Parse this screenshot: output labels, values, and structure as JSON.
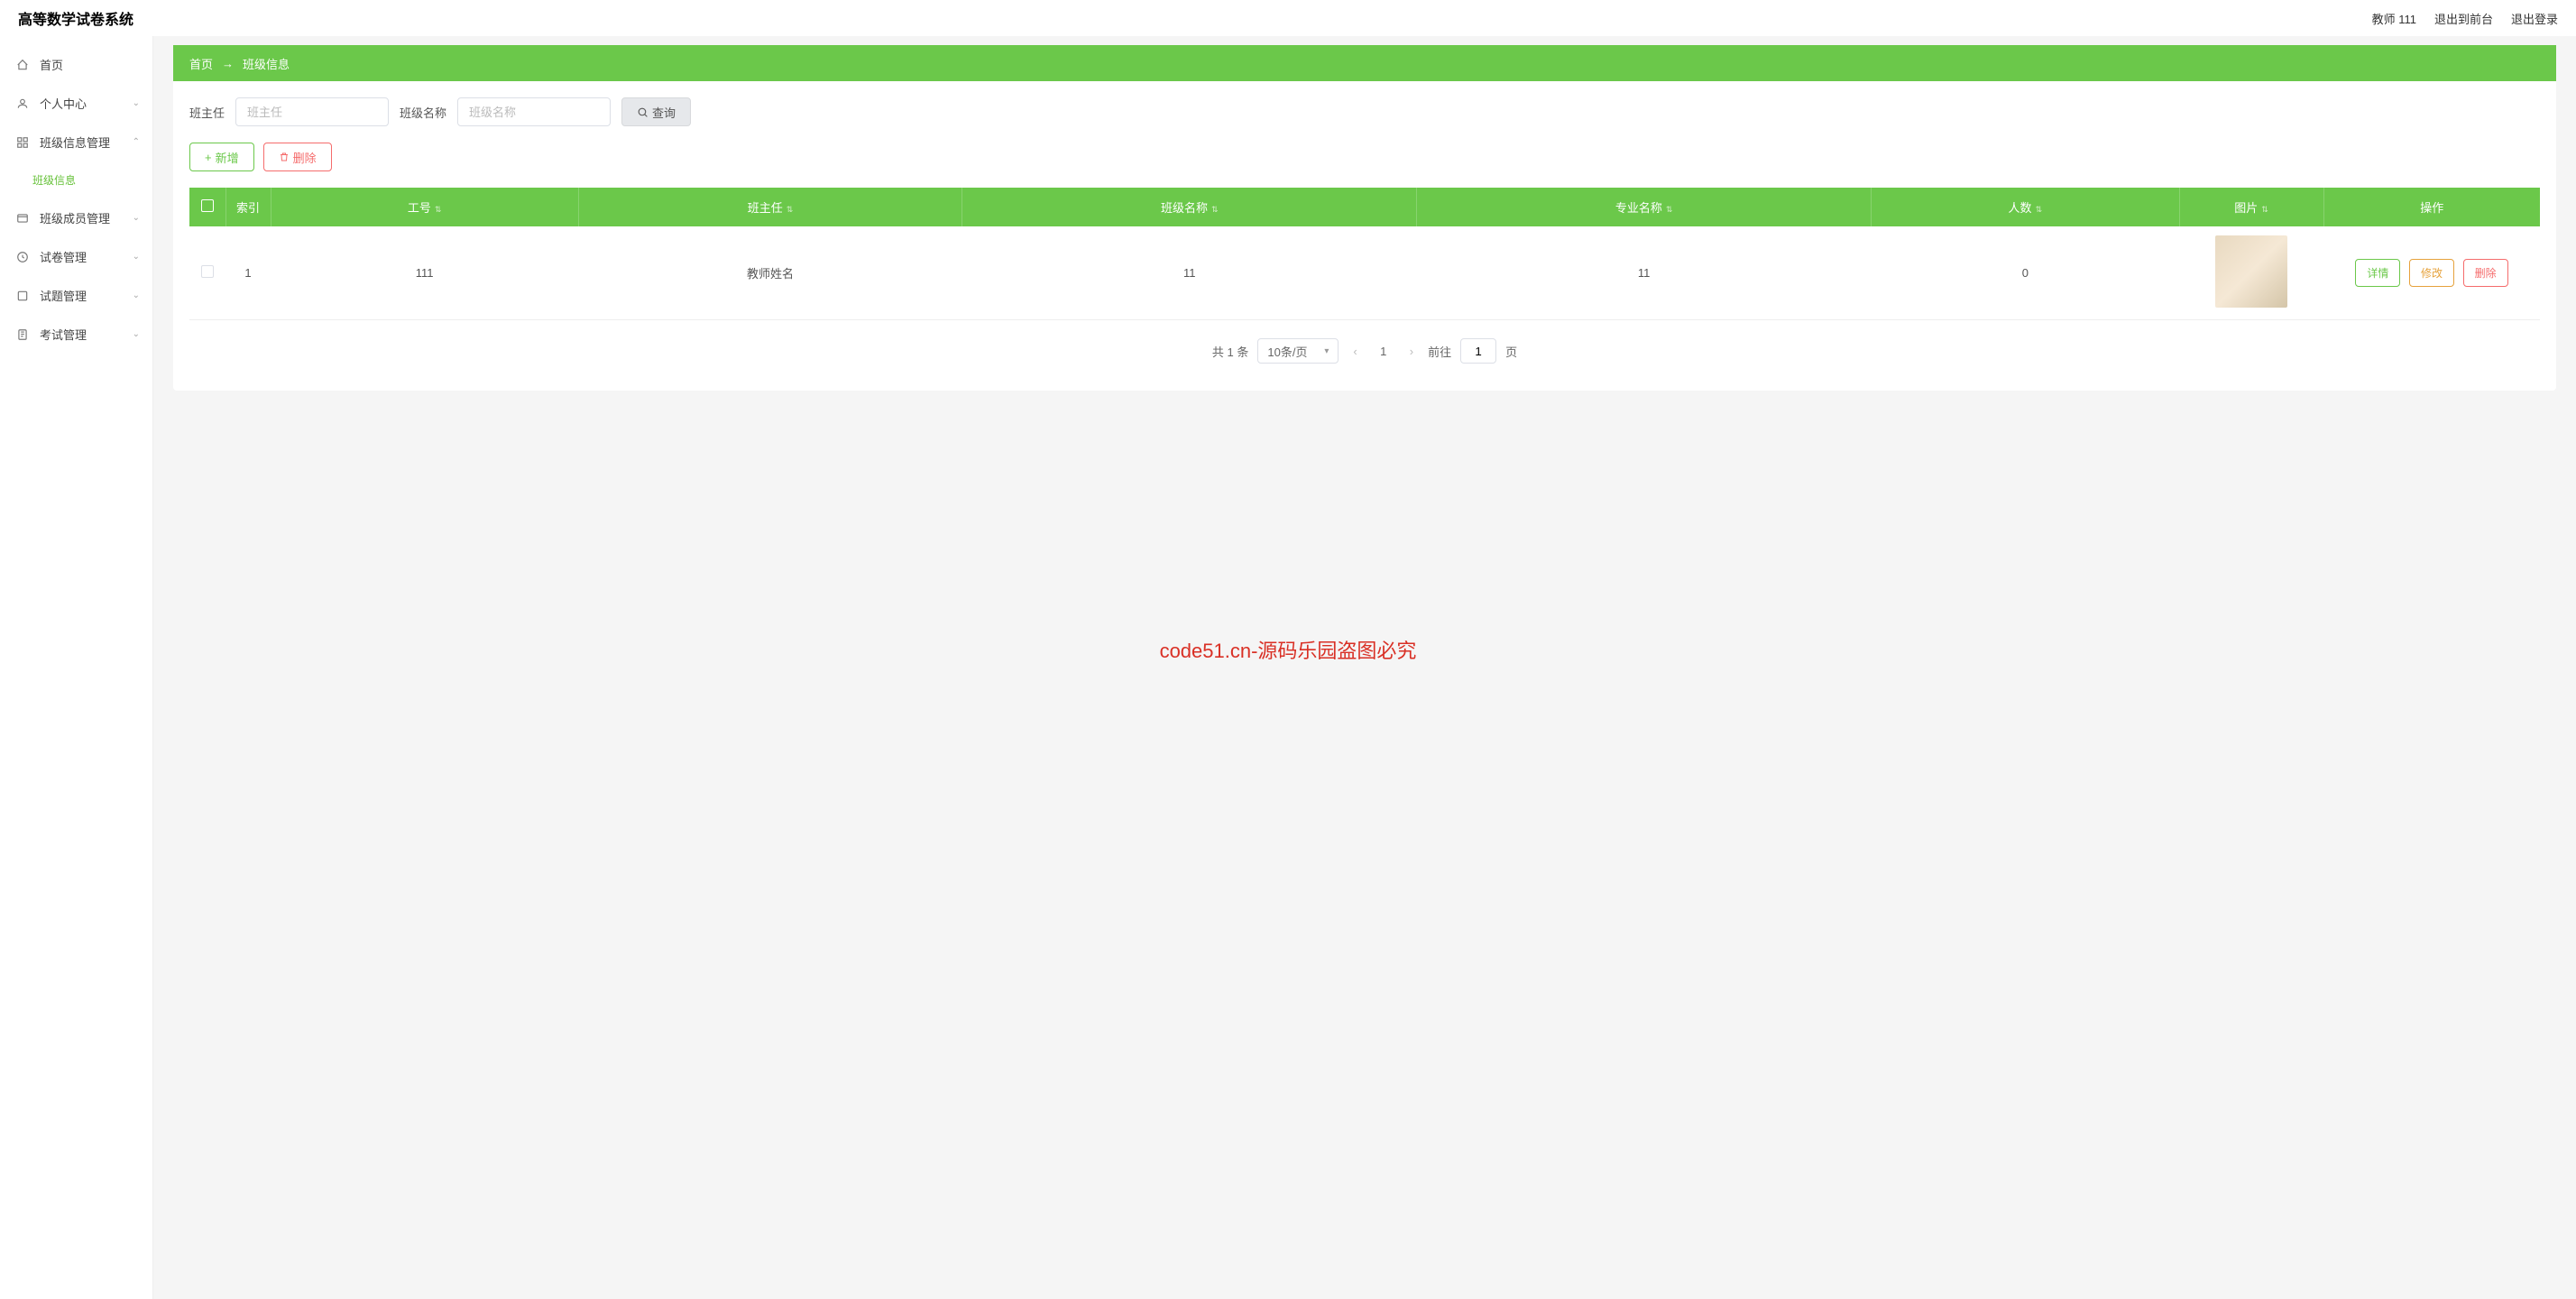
{
  "header": {
    "title": "高等数学试卷系统",
    "user": "教师 111",
    "links": {
      "user": "教师 111",
      "back_front": "退出到前台",
      "logout": "退出登录"
    }
  },
  "sidebar": {
    "items": [
      {
        "label": "首页",
        "icon": "home"
      },
      {
        "label": "个人中心",
        "icon": "user",
        "expandable": true
      },
      {
        "label": "班级信息管理",
        "icon": "grid",
        "expandable": true,
        "open": true
      },
      {
        "label": "班级信息",
        "sub": true
      },
      {
        "label": "班级成员管理",
        "icon": "members",
        "expandable": true
      },
      {
        "label": "试卷管理",
        "icon": "paper",
        "expandable": true
      },
      {
        "label": "试题管理",
        "icon": "question",
        "expandable": true
      },
      {
        "label": "考试管理",
        "icon": "exam",
        "expandable": true
      }
    ]
  },
  "breadcrumb": {
    "root": "首页",
    "current": "班级信息"
  },
  "filters": {
    "teacher_label": "班主任",
    "teacher_placeholder": "班主任",
    "class_label": "班级名称",
    "class_placeholder": "班级名称",
    "query_btn": "查询"
  },
  "actions": {
    "add": "新增",
    "delete": "删除"
  },
  "table": {
    "headers": {
      "index": "索引",
      "work_id": "工号",
      "teacher": "班主任",
      "class_name": "班级名称",
      "major": "专业名称",
      "count": "人数",
      "image": "图片",
      "ops": "操作"
    },
    "rows": [
      {
        "index": "1",
        "work_id": "111",
        "teacher": "教师姓名",
        "class_name": "11",
        "major": "11",
        "count": "0"
      }
    ],
    "row_actions": {
      "detail": "详情",
      "edit": "修改",
      "delete": "删除"
    }
  },
  "pagination": {
    "total": "共 1 条",
    "per_page": "10条/页",
    "current": "1",
    "goto_prefix": "前往",
    "goto_value": "1",
    "goto_suffix": "页"
  },
  "watermark": "code51.cn-源码乐园盗图必究"
}
